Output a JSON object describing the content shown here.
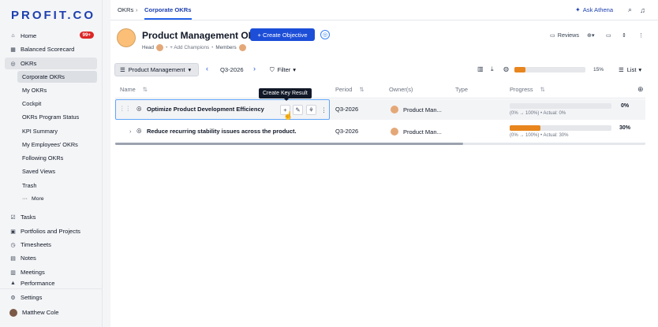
{
  "brand": {
    "logo": "PROFIT.CO"
  },
  "sidebar": {
    "items": [
      {
        "label": "Home",
        "icon": "home-icon",
        "badge": "99+"
      },
      {
        "label": "Balanced Scorecard",
        "icon": "scorecard-icon"
      },
      {
        "label": "OKRs",
        "icon": "target-icon"
      },
      {
        "label": "Tasks",
        "icon": "tasks-icon"
      },
      {
        "label": "Portfolios and Projects",
        "icon": "portfolio-icon"
      },
      {
        "label": "Timesheets",
        "icon": "clock-icon"
      },
      {
        "label": "Notes",
        "icon": "notes-icon"
      },
      {
        "label": "Meetings",
        "icon": "meetings-icon"
      },
      {
        "label": "Performance",
        "icon": "performance-icon"
      }
    ],
    "sub_items": [
      "Corporate OKRs",
      "My OKRs",
      "Cockpit",
      "OKRs Program Status",
      "KPI Summary",
      "My Employees' OKRs",
      "Following OKRs",
      "Saved Views",
      "Trash"
    ],
    "more": "More",
    "settings": "Settings",
    "user": "Matthew Cole"
  },
  "topbar": {
    "crumb_root": "OKRs",
    "crumb_sep": "›",
    "crumb_tab": "Corporate OKRs",
    "ask": "Ask Athena"
  },
  "header": {
    "title": "Product Management OKRs",
    "create_button": "+ Create Objective",
    "head_label": "Head",
    "add_champions": "+ Add Champions",
    "members_label": "Members",
    "reviews": "Reviews"
  },
  "toolbar": {
    "department": "Product Management",
    "period": "Q3-2026",
    "filter": "Filter",
    "overall_progress": 0.15,
    "overall_pct": "15%",
    "view": "List"
  },
  "table": {
    "columns": [
      "Name",
      "Period",
      "Owner(s)",
      "Type",
      "Progress"
    ],
    "rows": [
      {
        "name": "Optimize Product Development Efficiency",
        "period": "Q3-2026",
        "owner": "Product Man...",
        "type": "",
        "progress": 0,
        "pct": "0%",
        "note": "(0% → 100%) • Actual: 0%"
      },
      {
        "name": "Reduce recurring stability issues across the product.",
        "period": "Q3-2026",
        "owner": "Product Man...",
        "type": "",
        "progress": 0.3,
        "pct": "30%",
        "note": "(0% → 100%) • Actual: 30%"
      }
    ]
  },
  "tooltip": "Create Key Result",
  "colors": {
    "accent": "#1d4ed8",
    "progress": "#e8851d"
  }
}
